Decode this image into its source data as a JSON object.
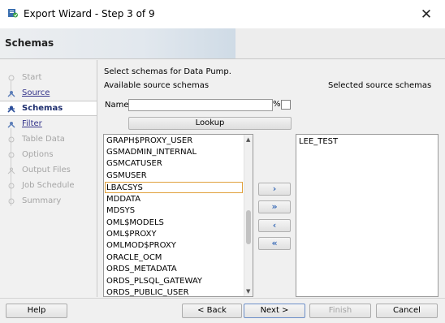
{
  "window": {
    "title": "Export Wizard - Step 3 of 9",
    "close_glyph": "✕",
    "icon": "app-icon"
  },
  "header": {
    "title": "Schemas"
  },
  "nav": {
    "items": [
      {
        "label": "Start",
        "state": "disabled"
      },
      {
        "label": "Source",
        "state": "link"
      },
      {
        "label": "Schemas",
        "state": "active"
      },
      {
        "label": "Filter",
        "state": "link"
      },
      {
        "label": "Table Data",
        "state": "disabled"
      },
      {
        "label": "Options",
        "state": "disabled"
      },
      {
        "label": "Output Files",
        "state": "disabled"
      },
      {
        "label": "Job Schedule",
        "state": "disabled"
      },
      {
        "label": "Summary",
        "state": "disabled"
      }
    ]
  },
  "main": {
    "instruction": "Select schemas for Data Pump.",
    "available_label": "Available source schemas",
    "selected_label": "Selected source schemas",
    "name_label": "Name",
    "name_value": "",
    "percent_label": "%",
    "lookup_label": "Lookup",
    "available_schemas": [
      "GRAPH$PROXY_USER",
      "GSMADMIN_INTERNAL",
      "GSMCATUSER",
      "GSMUSER",
      "LBACSYS",
      "MDDATA",
      "MDSYS",
      "OML$MODELS",
      "OML$PROXY",
      "OMLMOD$PROXY",
      "ORACLE_OCM",
      "ORDS_METADATA",
      "ORDS_PLSQL_GATEWAY",
      "ORDS_PUBLIC_USER"
    ],
    "selected_available": "LBACSYS",
    "selected_schemas": [
      "LEE_TEST"
    ],
    "move_buttons": {
      "add_one": "›",
      "add_all": "»",
      "remove_one": "‹",
      "remove_all": "«"
    }
  },
  "footer": {
    "help": "Help",
    "back": "< Back",
    "next": "Next >",
    "finish": "Finish",
    "cancel": "Cancel"
  },
  "colors": {
    "accent": "#3c6db8",
    "selection_border": "#e0a03c"
  }
}
